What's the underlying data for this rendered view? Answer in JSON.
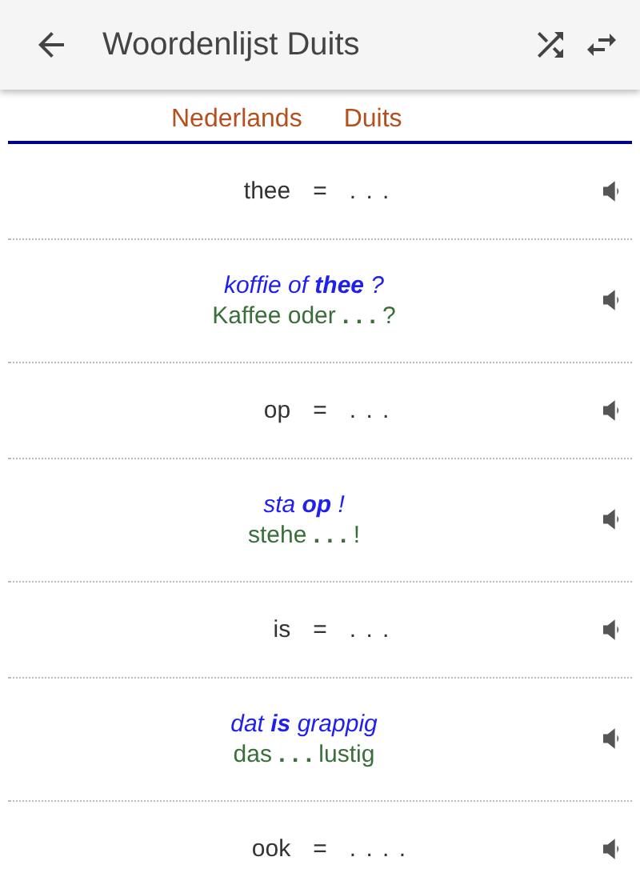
{
  "app_bar": {
    "title": "Woordenlijst Duits"
  },
  "tabs": [
    {
      "label": "Nederlands"
    },
    {
      "label": "Duits"
    }
  ],
  "entries": [
    {
      "kind": "word",
      "word": "thee",
      "equals": "=",
      "answer": ". . ."
    },
    {
      "kind": "sentence",
      "source": "koffie of **thee** ?",
      "target": "Kaffee oder **. . .** ?"
    },
    {
      "kind": "word",
      "word": "op",
      "equals": "=",
      "answer": ". . ."
    },
    {
      "kind": "sentence",
      "source": "sta **op** !",
      "target": "stehe **. . .** !"
    },
    {
      "kind": "word",
      "word": "is",
      "equals": "=",
      "answer": ". . ."
    },
    {
      "kind": "sentence",
      "source": "dat **is** grappig",
      "target": "das **. . .** lustig"
    },
    {
      "kind": "word",
      "word": "ook",
      "equals": "=",
      "answer": ". . . ."
    }
  ]
}
